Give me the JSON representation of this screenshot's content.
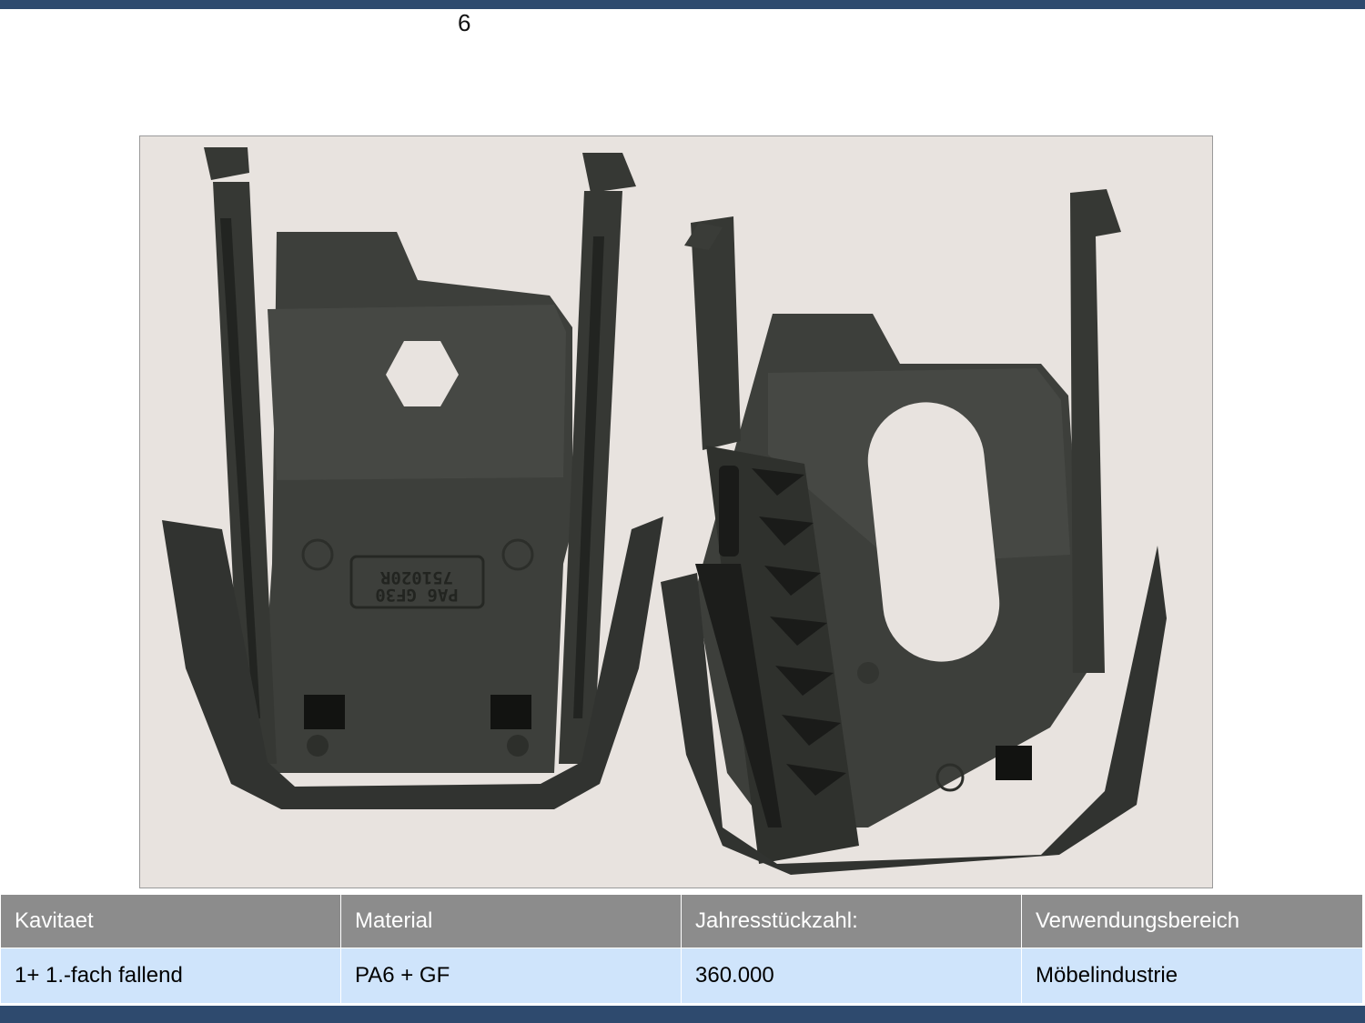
{
  "page": {
    "number": "6"
  },
  "colors": {
    "bar": "#2e4a6e",
    "header_bg": "#8c8c8c",
    "row_bg": "#cfe4fb",
    "photo_bg": "#e8e3df",
    "part": "#3a3c38"
  },
  "table": {
    "headers": [
      "Kavitaet",
      "Material",
      "Jahresstückzahl:",
      "Verwendungsbereich"
    ],
    "row": [
      "1+ 1.-fach fallend",
      "PA6 + GF",
      "360.000",
      "Möbelindustrie"
    ]
  },
  "part_marking": [
    "751020R",
    "PA6 GF30"
  ]
}
